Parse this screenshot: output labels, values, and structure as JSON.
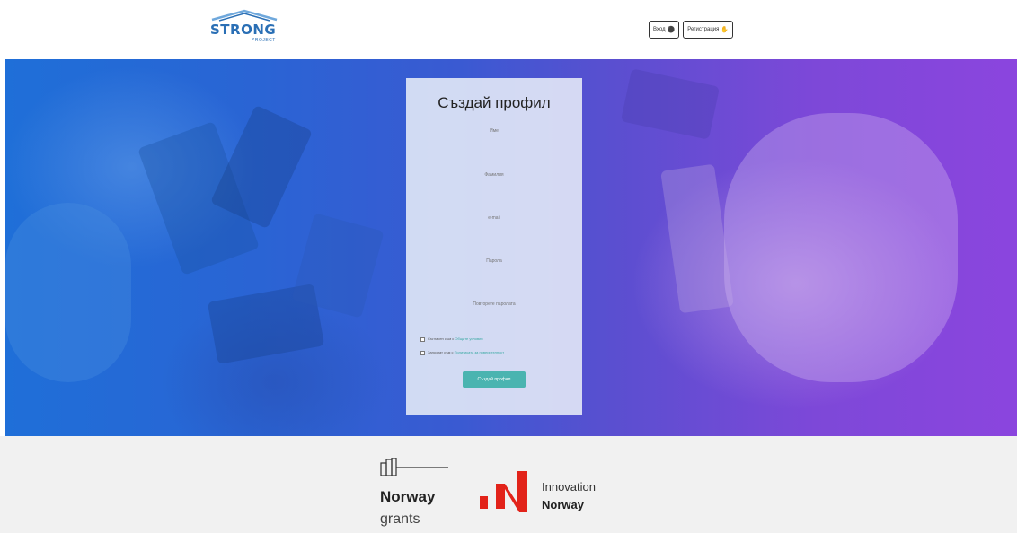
{
  "header": {
    "logo": {
      "word": "STRONG",
      "sub": "PROJECT"
    },
    "nav": {
      "login_label": "Вход",
      "register_label": "Регистрация"
    }
  },
  "form": {
    "title": "Създай профил",
    "fields": {
      "first_name": "Име",
      "last_name": "Фамилия",
      "email": "e-mail",
      "password": "Парола",
      "password_repeat": "Повторете паролата"
    },
    "consent_1": {
      "text": "Съгласен съм с ",
      "link": "Общите условия"
    },
    "consent_2": {
      "text": "Запознат съм с ",
      "link": "Политиката за поверителност"
    },
    "submit_label": "Създай профил"
  },
  "footer": {
    "norway_grants": {
      "line1": "Norway",
      "line2": "grants"
    },
    "innovation_norway": {
      "line1": "Innovation",
      "line2": "Norway"
    }
  },
  "colors": {
    "accent_teal": "#4ab4b0",
    "logo_blue": "#2a6fb5",
    "innovation_red": "#e2231a"
  }
}
